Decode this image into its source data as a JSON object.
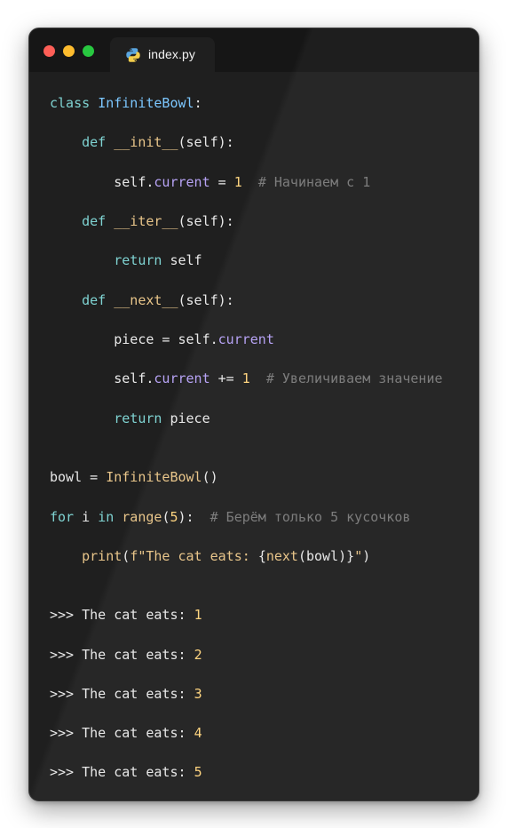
{
  "window": {
    "tab_title": "index.py",
    "traffic_lights": [
      "close",
      "minimize",
      "maximize"
    ],
    "colors": {
      "background": "#1f1f1f",
      "keyword": "#7fd3d2",
      "class_name": "#7cc7ff",
      "function": "#e8c58a",
      "attribute": "#b7a3f5",
      "number": "#ffd580",
      "comment": "#7d7d7d"
    }
  },
  "code": {
    "l1": {
      "kw": "class",
      "sp": " ",
      "name": "InfiniteBowl",
      "end": ":"
    },
    "l2": {
      "indent": "    ",
      "kw": "def",
      "sp": " ",
      "name": "__init__",
      "args": "(self):"
    },
    "l3": {
      "indent": "        ",
      "obj": "self.",
      "attr": "current",
      "op": " = ",
      "num": "1",
      "sp": "  ",
      "comment": "# Начинаем с 1"
    },
    "l4": {
      "indent": "    ",
      "kw": "def",
      "sp": " ",
      "name": "__iter__",
      "args": "(self):"
    },
    "l5": {
      "indent": "        ",
      "kw": "return",
      "rest": " self"
    },
    "l6": {
      "indent": "    ",
      "kw": "def",
      "sp": " ",
      "name": "__next__",
      "args": "(self):"
    },
    "l7": {
      "indent": "        ",
      "pre": "piece = self.",
      "attr": "current"
    },
    "l8": {
      "indent": "        ",
      "obj": "self.",
      "attr": "current",
      "op": " += ",
      "num": "1",
      "sp": "  ",
      "comment": "# Увеличиваем значение"
    },
    "l9": {
      "indent": "        ",
      "kw": "return",
      "rest": " piece"
    },
    "l10": {
      "pre": "bowl = ",
      "name": "InfiniteBowl",
      "end": "()"
    },
    "l11": {
      "kw1": "for",
      "mid1": " i ",
      "kw2": "in",
      "sp": " ",
      "fn": "range",
      "open": "(",
      "num": "5",
      "close": "):",
      "sp2": "  ",
      "comment": "# Берём только 5 кусочков"
    },
    "l12": {
      "indent": "    ",
      "fn": "print",
      "open": "(",
      "str1": "f\"The cat eats: ",
      "brace1": "{",
      "fn2": "next",
      "inner": "(bowl)",
      "brace2": "}",
      "str2": "\"",
      "close": ")"
    }
  },
  "output": [
    {
      "prompt": ">>> The cat eats: ",
      "value": "1"
    },
    {
      "prompt": ">>> The cat eats: ",
      "value": "2"
    },
    {
      "prompt": ">>> The cat eats: ",
      "value": "3"
    },
    {
      "prompt": ">>> The cat eats: ",
      "value": "4"
    },
    {
      "prompt": ">>> The cat eats: ",
      "value": "5"
    }
  ]
}
